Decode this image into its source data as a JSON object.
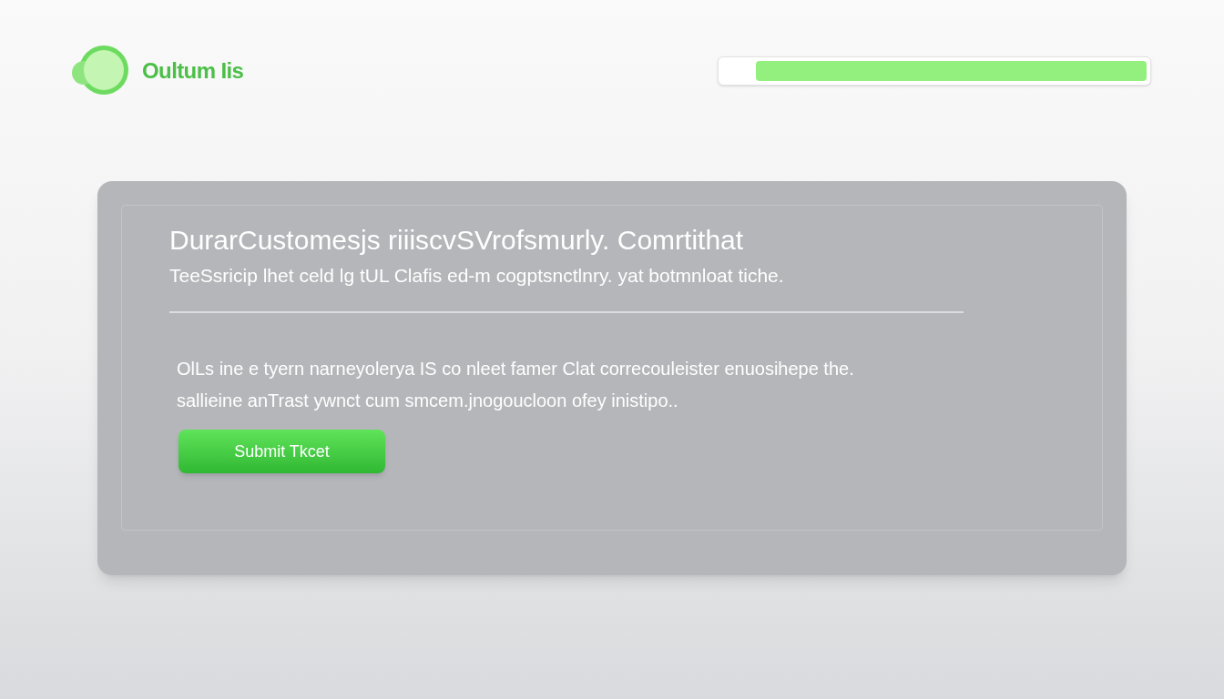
{
  "brand": {
    "name": "Oultum Iis"
  },
  "progress": {
    "level": 0.92
  },
  "card": {
    "title": "DurarCustomesjs riiiscvSVrofsmurly. Comrtithat",
    "subtitle": "TeeSsricip lhet celd lg tUL Clafis ed-m cogptsnctlnry. yat botmnloat tiche.",
    "body_lines": [
      "OlLs ine e tyern narneyolerya IS co nleet famer Clat correcouleister enuosihepe the.",
      "sallieine anTrast ywnct cum smcem.jnogoucloon ofey inistipo.."
    ],
    "button": "Submit Tkcet"
  }
}
